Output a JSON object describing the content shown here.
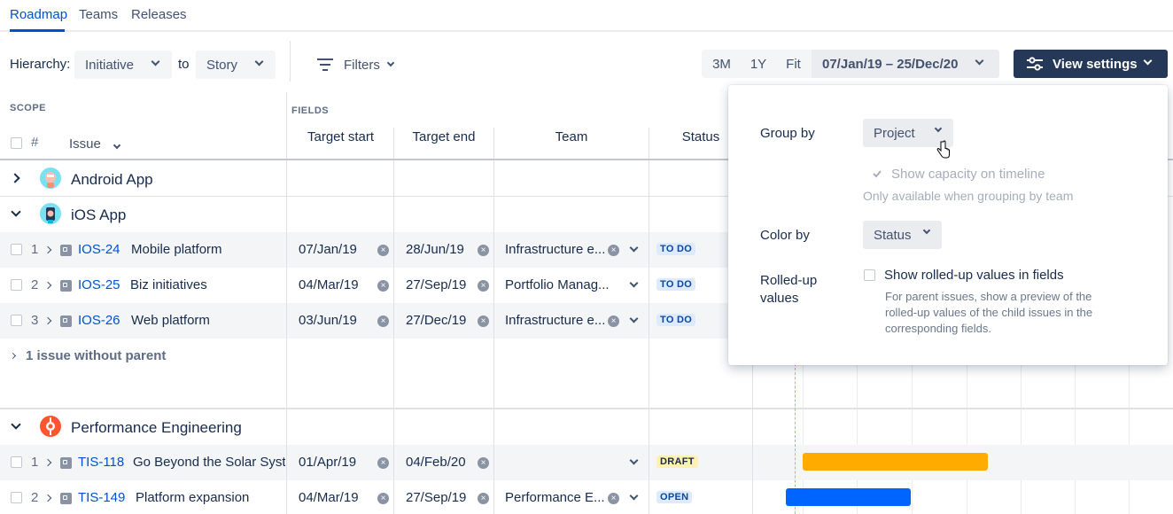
{
  "tabs": [
    {
      "label": "Roadmap",
      "active": true
    },
    {
      "label": "Teams",
      "active": false
    },
    {
      "label": "Releases",
      "active": false
    }
  ],
  "toolbar": {
    "hierarchy_label": "Hierarchy:",
    "hierarchy_from": "Initiative",
    "to_label": "to",
    "hierarchy_to": "Story",
    "filters_label": "Filters",
    "zoom_options": [
      "3M",
      "1Y",
      "Fit"
    ],
    "date_range": "07/Jan/19 – 25/Dec/20",
    "view_settings_label": "View settings"
  },
  "table": {
    "scope_label": "SCOPE",
    "fields_label": "FIELDS",
    "hash_label": "#",
    "issue_label": "Issue",
    "columns": [
      "Target start",
      "Target end",
      "Team",
      "Status"
    ]
  },
  "groups": [
    {
      "name": "Android App",
      "expanded": false
    },
    {
      "name": "iOS App",
      "expanded": true,
      "rows": [
        {
          "num": "1",
          "key": "IOS-24",
          "summary": "Mobile platform",
          "start": "07/Jan/19",
          "end": "28/Jun/19",
          "team": "Infrastructure e...",
          "status": "TO DO"
        },
        {
          "num": "2",
          "key": "IOS-25",
          "summary": "Biz initiatives",
          "start": "04/Mar/19",
          "end": "27/Sep/19",
          "team": "Portfolio Manag...",
          "status": "TO DO"
        },
        {
          "num": "3",
          "key": "IOS-26",
          "summary": "Web platform",
          "start": "03/Jun/19",
          "end": "27/Dec/19",
          "team": "Infrastructure e...",
          "status": "TO DO"
        }
      ],
      "without_parent": "1 issue without parent"
    },
    {
      "name": "Performance Engineering",
      "expanded": true,
      "rows": [
        {
          "num": "1",
          "key": "TIS-118",
          "summary": "Go Beyond the Solar Syste",
          "start": "01/Apr/19",
          "end": "04/Feb/20",
          "team": "",
          "status": "DRAFT"
        },
        {
          "num": "2",
          "key": "TIS-149",
          "summary": "Platform expansion",
          "start": "04/Mar/19",
          "end": "27/Sep/19",
          "team": "Performance E...",
          "status": "OPEN"
        }
      ]
    }
  ],
  "view_settings": {
    "group_by_label": "Group by",
    "group_by_value": "Project",
    "show_capacity_label": "Show capacity on timeline",
    "capacity_note": "Only available when grouping by team",
    "color_by_label": "Color by",
    "color_by_value": "Status",
    "rolled_up_label_1": "Rolled-up",
    "rolled_up_label_2": "values",
    "rolled_up_checkbox_label": "Show rolled-up values in fields",
    "rolled_up_help_1": "For parent issues, show a preview of the",
    "rolled_up_help_2": "rolled-up values of the child issues in the",
    "rolled_up_help_3": "corresponding fields."
  },
  "colors": {
    "accent": "#0052cc",
    "navy": "#253858",
    "bar_yellow": "#ffab00",
    "bar_blue": "#0065ff"
  }
}
